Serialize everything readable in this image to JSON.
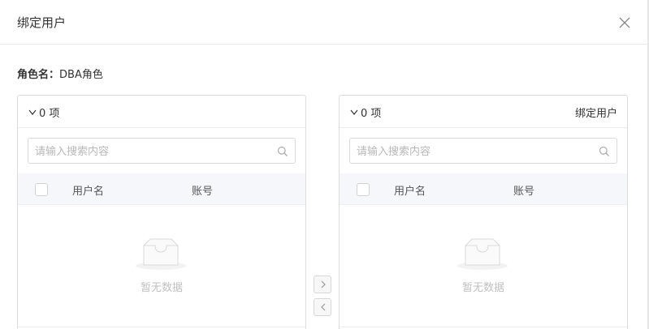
{
  "dialog": {
    "title": "绑定用户",
    "close_icon": "close-icon"
  },
  "role": {
    "label": "角色名：",
    "value": "DBA角色"
  },
  "left_panel": {
    "count": "0 项",
    "search_placeholder": "请输入搜索内容",
    "columns": [
      "用户名",
      "账号"
    ],
    "empty_text": "暂无数据"
  },
  "right_panel": {
    "count": "0 项",
    "title": "绑定用户",
    "search_placeholder": "请输入搜索内容",
    "columns": [
      "用户名",
      "账号"
    ],
    "empty_text": "暂无数据"
  },
  "transfer": {
    "to_right_icon": "chevron-right-icon",
    "to_left_icon": "chevron-left-icon"
  },
  "colors": {
    "border": "#dcdcdc",
    "header_bg": "#f5f7fa",
    "placeholder": "#b8b8b8",
    "empty_text": "#c0c0c0"
  }
}
